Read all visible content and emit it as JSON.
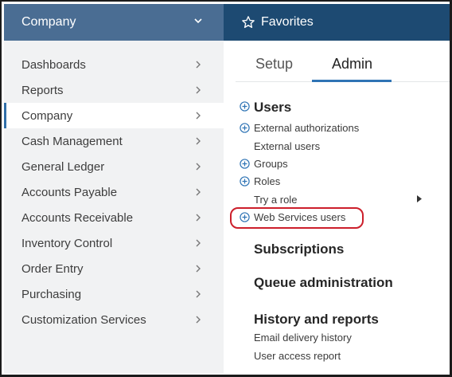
{
  "left_panel": {
    "header": {
      "title": "Company"
    },
    "menu": [
      {
        "label": "Dashboards",
        "active": false
      },
      {
        "label": "Reports",
        "active": false
      },
      {
        "label": "Company",
        "active": true
      },
      {
        "label": "Cash Management",
        "active": false
      },
      {
        "label": "General Ledger",
        "active": false
      },
      {
        "label": "Accounts Payable",
        "active": false
      },
      {
        "label": "Accounts Receivable",
        "active": false
      },
      {
        "label": "Inventory Control",
        "active": false
      },
      {
        "label": "Order Entry",
        "active": false
      },
      {
        "label": "Purchasing",
        "active": false
      },
      {
        "label": "Customization Services",
        "active": false
      }
    ]
  },
  "right_panel": {
    "header": {
      "title": "Favorites"
    },
    "tabs": [
      {
        "label": "Setup",
        "selected": false
      },
      {
        "label": "Admin",
        "selected": true
      }
    ],
    "users": {
      "heading": "Users",
      "links": [
        {
          "label": "External authorizations",
          "expandable": true
        },
        {
          "label": "External users",
          "expandable": false
        },
        {
          "label": "Groups",
          "expandable": true
        },
        {
          "label": "Roles",
          "expandable": true
        },
        {
          "label": "Try a role",
          "expandable": false,
          "submenu": true
        },
        {
          "label": "Web Services users",
          "expandable": true,
          "highlighted": true
        }
      ]
    },
    "subscriptions": {
      "heading": "Subscriptions"
    },
    "queue": {
      "heading": "Queue administration"
    },
    "history": {
      "heading": "History and reports",
      "links": [
        {
          "label": "Email delivery history"
        },
        {
          "label": "User access report"
        }
      ]
    }
  },
  "colors": {
    "left_header_bg": "#4a6d93",
    "right_header_bg": "#1d4a72",
    "sidebar_bg": "#f1f2f3",
    "active_indicator": "#2f6ea8",
    "tab_underline": "#2f74b5",
    "plus_icon": "#2f74b5",
    "highlight_outline": "#cc1f2b"
  },
  "icons": {
    "left_header": "chevron-down-icon",
    "right_header": "star-icon",
    "menu_item": "chevron-right-icon",
    "expand": "plus-circle-icon",
    "submenu": "triangle-right-icon"
  }
}
